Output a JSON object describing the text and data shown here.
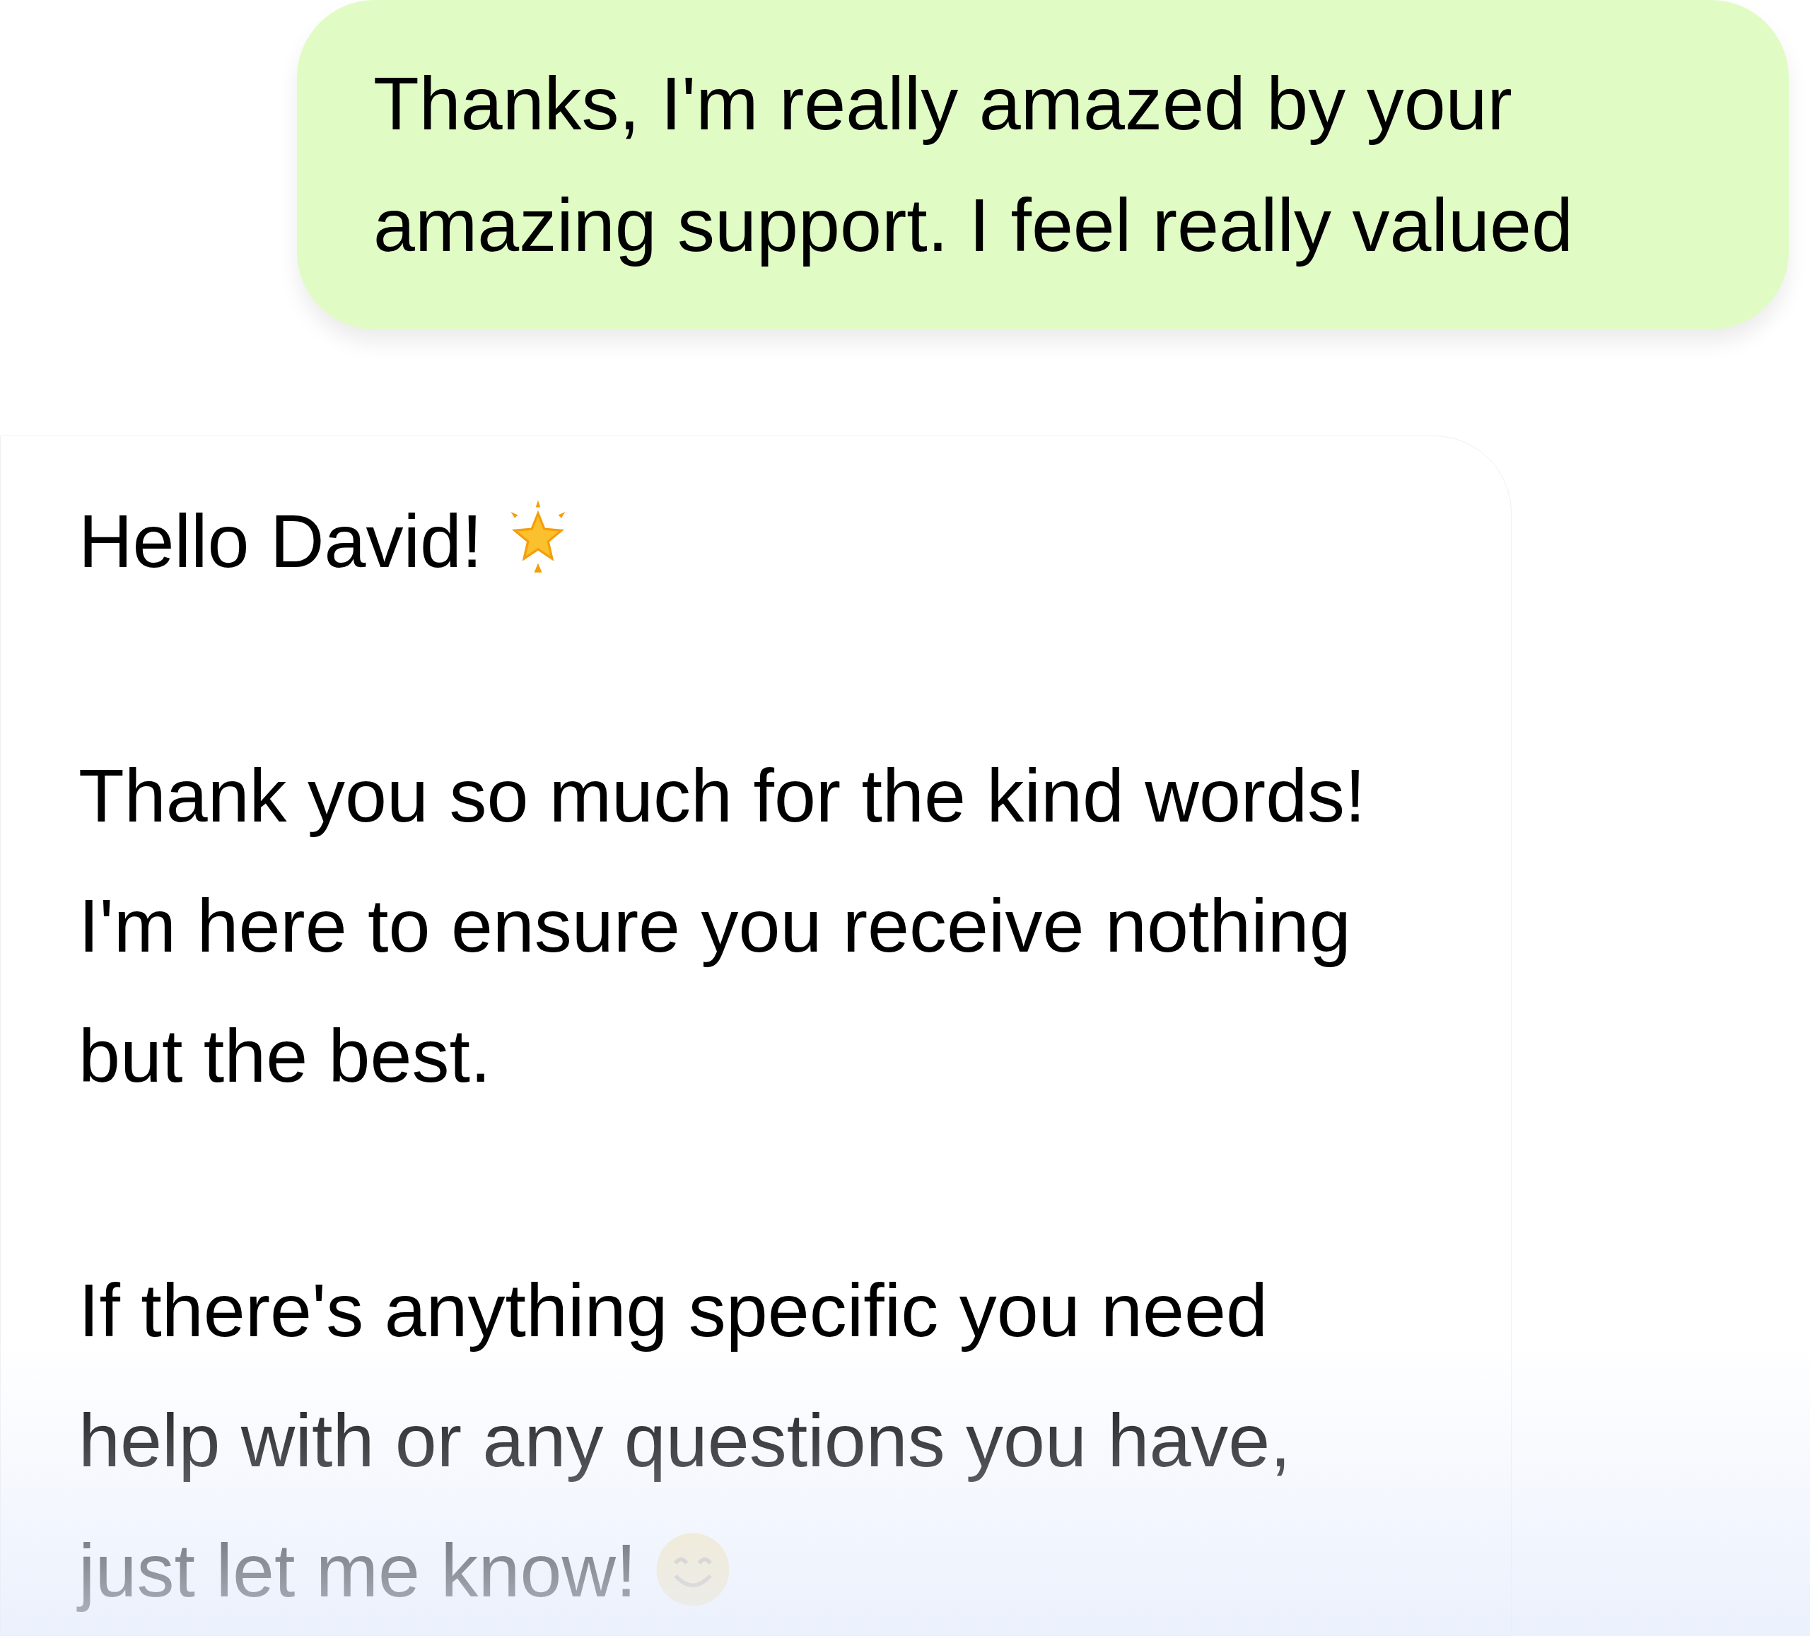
{
  "messages": [
    {
      "kind": "sent",
      "paragraphs": [
        {
          "text": "Thanks, I'm really amazed by your amazing support. I feel really valued"
        }
      ]
    },
    {
      "kind": "received",
      "paragraphs": [
        {
          "text": "Hello David!"
        },
        {
          "text": "Thank you so much for the kind words! I'm here to ensure you receive nothing but the best."
        },
        {
          "text": "If there's anything specific you need help with or any questions you have, just let me know!"
        }
      ]
    }
  ]
}
